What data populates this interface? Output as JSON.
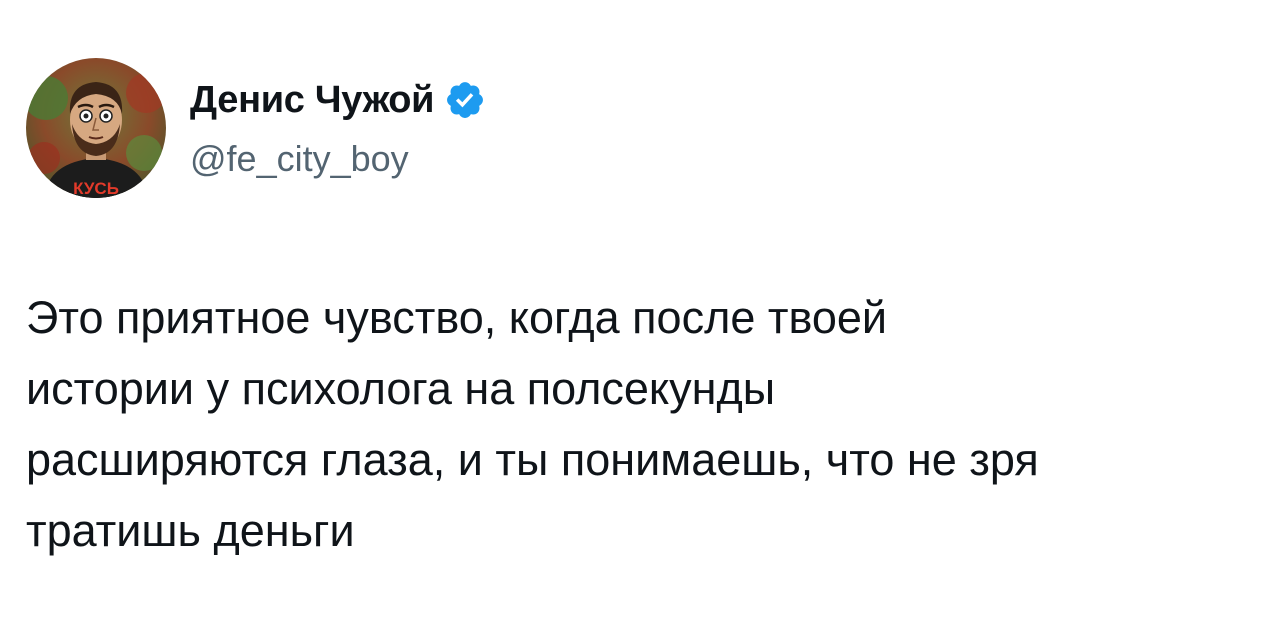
{
  "author": {
    "display_name": "Денис Чужой",
    "handle": "@fe_city_boy",
    "verified": true,
    "verified_color": "#1d9bf0",
    "avatar": {
      "badge_text": "КУСЬ",
      "icon": "avatar-portrait"
    }
  },
  "tweet": {
    "lines": [
      "Это приятное чувство, когда после твоей",
      "истории у психолога на полсекунды",
      "расширяются глаза, и ты понимаешь, что не зря",
      "тратишь деньги"
    ]
  },
  "colors": {
    "text_primary": "#0f1419",
    "text_secondary": "#536471",
    "background": "#ffffff"
  }
}
